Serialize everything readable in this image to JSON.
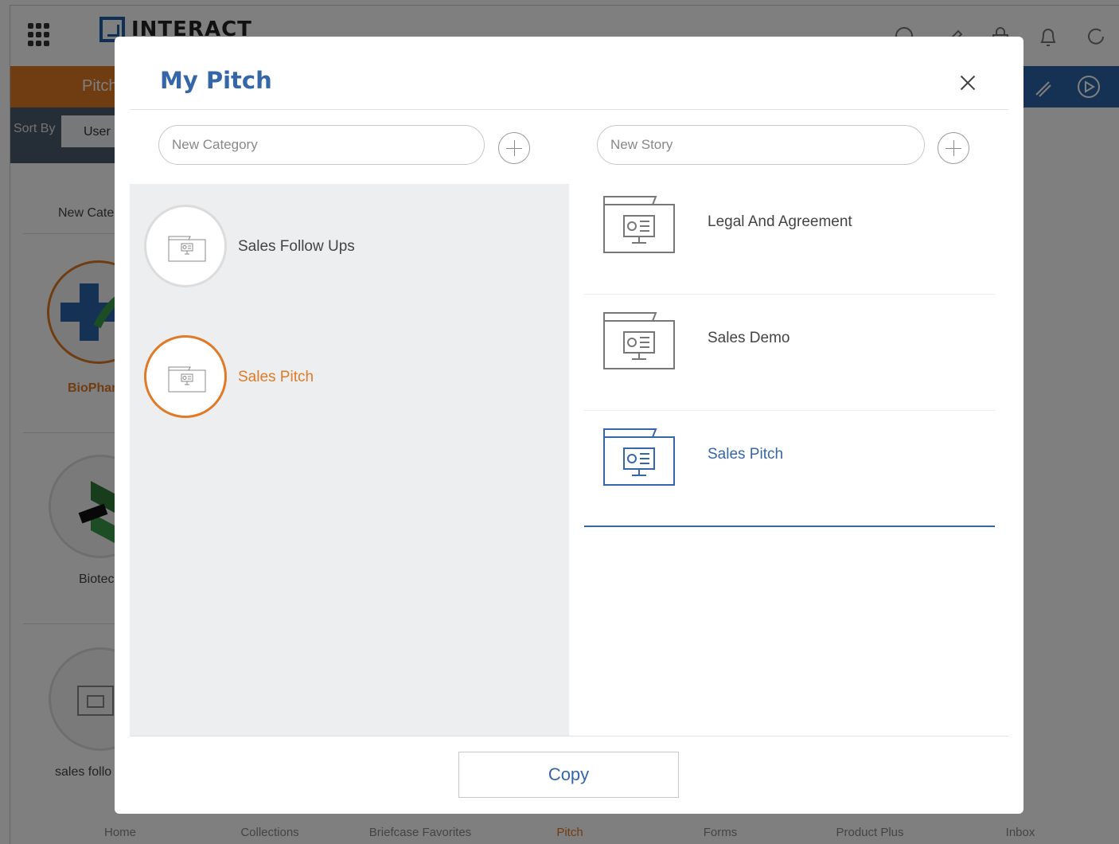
{
  "app": {
    "logo_text": "INTERACT",
    "header_title": "Pitch",
    "sort_label": "Sort By",
    "sort_value": "User",
    "bg_cards": [
      "New Cate",
      "BioPhar",
      "Biotec",
      "sales follo"
    ],
    "bottom_nav": [
      "Home",
      "Collections",
      "Briefcase Favorites",
      "Pitch",
      "Forms",
      "Product Plus",
      "Inbox"
    ],
    "active_nav": "Pitch"
  },
  "modal": {
    "title": "My Pitch",
    "category_placeholder": "New Category",
    "story_placeholder": "New Story",
    "categories": [
      {
        "label": "Sales Follow Ups",
        "selected": false
      },
      {
        "label": "Sales Pitch",
        "selected": true
      }
    ],
    "stories": [
      {
        "label": "Legal And Agreement",
        "selected": false
      },
      {
        "label": "Sales Demo",
        "selected": false
      },
      {
        "label": "Sales Pitch",
        "selected": true
      }
    ],
    "copy_label": "Copy"
  },
  "colors": {
    "accent_blue": "#3566a8",
    "accent_orange": "#e07a26",
    "panel_gray": "#eceeef"
  }
}
